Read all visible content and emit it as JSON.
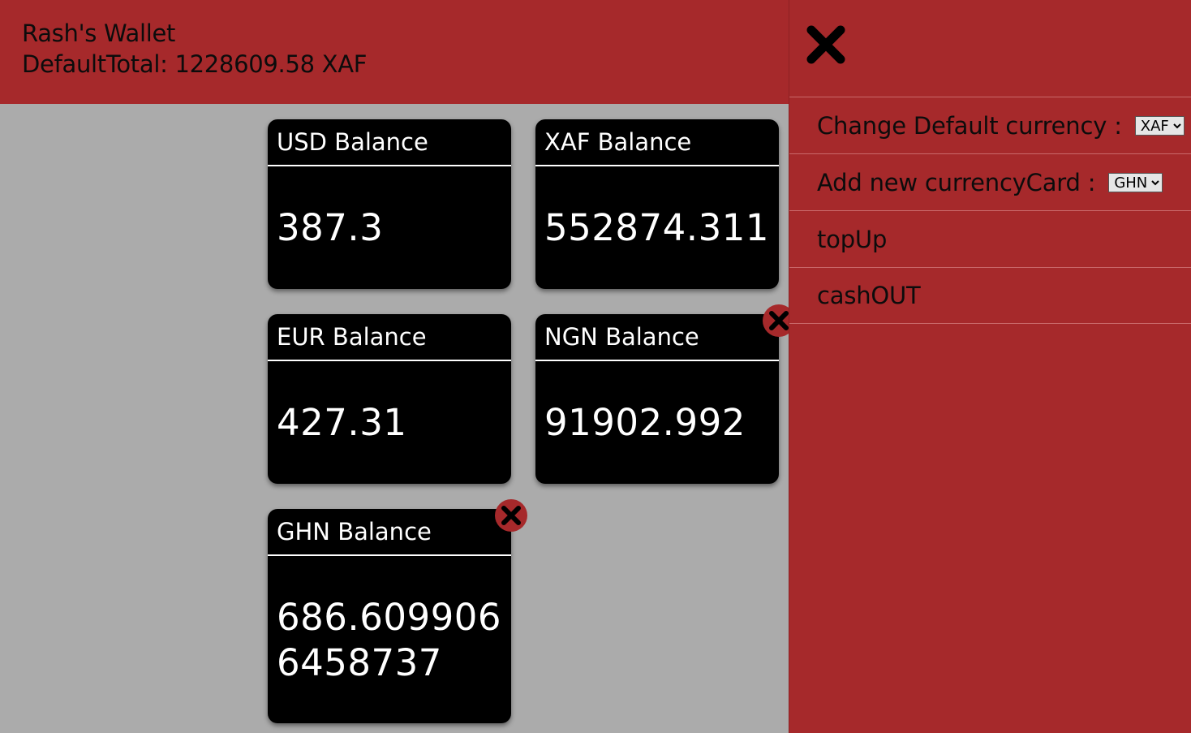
{
  "header": {
    "wallet_name": "Rash's Wallet",
    "default_total": "DefaultTotal: 1228609.58 XAF"
  },
  "cards": [
    {
      "label": "USD Balance",
      "value": "387.3"
    },
    {
      "label": "XAF Balance",
      "value": "552874.311"
    },
    {
      "label": "EUR Balance",
      "value": "427.31"
    },
    {
      "label": "NGN Balance",
      "value": "91902.992"
    },
    {
      "label": "GHN Balance",
      "value": "686.6099066458737"
    }
  ],
  "panel": {
    "close_icon": "close-x-icon",
    "menu": {
      "change_default_label": "Change Default currency :",
      "change_default_value": "XAF",
      "add_card_label": "Add new currencyCard :",
      "add_card_value": "GHN",
      "topup_label": "topUp",
      "cashout_label": "cashOUT"
    }
  },
  "colors": {
    "accent_red": "#a6292b",
    "background_gray": "#ababab",
    "card_black": "#000000"
  }
}
